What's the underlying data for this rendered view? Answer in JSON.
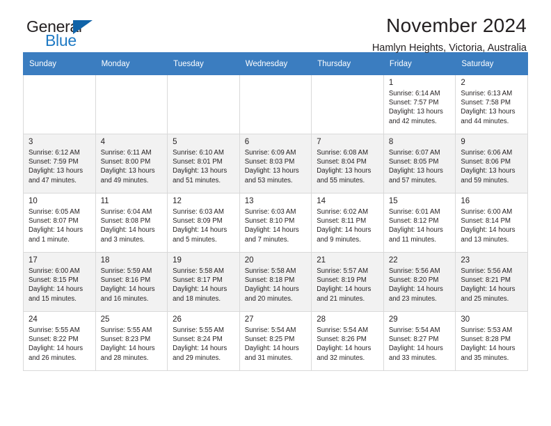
{
  "brand": {
    "name_top": "General",
    "name_bottom": "Blue",
    "triangle_icon": "triangle-icon",
    "colors": {
      "blue": "#1f7ac4",
      "dark_blue": "#1063a8",
      "text": "#231f20"
    }
  },
  "header": {
    "title": "November 2024",
    "subtitle": "Hamlyn Heights, Victoria, Australia"
  },
  "calendar": {
    "header_bg": "#3b7dc0",
    "weekdays": [
      "Sunday",
      "Monday",
      "Tuesday",
      "Wednesday",
      "Thursday",
      "Friday",
      "Saturday"
    ],
    "weeks": [
      [
        {
          "day": "",
          "sunrise": "",
          "sunset": "",
          "daylight": ""
        },
        {
          "day": "",
          "sunrise": "",
          "sunset": "",
          "daylight": ""
        },
        {
          "day": "",
          "sunrise": "",
          "sunset": "",
          "daylight": ""
        },
        {
          "day": "",
          "sunrise": "",
          "sunset": "",
          "daylight": ""
        },
        {
          "day": "",
          "sunrise": "",
          "sunset": "",
          "daylight": ""
        },
        {
          "day": "1",
          "sunrise": "Sunrise: 6:14 AM",
          "sunset": "Sunset: 7:57 PM",
          "daylight": "Daylight: 13 hours and 42 minutes."
        },
        {
          "day": "2",
          "sunrise": "Sunrise: 6:13 AM",
          "sunset": "Sunset: 7:58 PM",
          "daylight": "Daylight: 13 hours and 44 minutes."
        }
      ],
      [
        {
          "day": "3",
          "sunrise": "Sunrise: 6:12 AM",
          "sunset": "Sunset: 7:59 PM",
          "daylight": "Daylight: 13 hours and 47 minutes."
        },
        {
          "day": "4",
          "sunrise": "Sunrise: 6:11 AM",
          "sunset": "Sunset: 8:00 PM",
          "daylight": "Daylight: 13 hours and 49 minutes."
        },
        {
          "day": "5",
          "sunrise": "Sunrise: 6:10 AM",
          "sunset": "Sunset: 8:01 PM",
          "daylight": "Daylight: 13 hours and 51 minutes."
        },
        {
          "day": "6",
          "sunrise": "Sunrise: 6:09 AM",
          "sunset": "Sunset: 8:03 PM",
          "daylight": "Daylight: 13 hours and 53 minutes."
        },
        {
          "day": "7",
          "sunrise": "Sunrise: 6:08 AM",
          "sunset": "Sunset: 8:04 PM",
          "daylight": "Daylight: 13 hours and 55 minutes."
        },
        {
          "day": "8",
          "sunrise": "Sunrise: 6:07 AM",
          "sunset": "Sunset: 8:05 PM",
          "daylight": "Daylight: 13 hours and 57 minutes."
        },
        {
          "day": "9",
          "sunrise": "Sunrise: 6:06 AM",
          "sunset": "Sunset: 8:06 PM",
          "daylight": "Daylight: 13 hours and 59 minutes."
        }
      ],
      [
        {
          "day": "10",
          "sunrise": "Sunrise: 6:05 AM",
          "sunset": "Sunset: 8:07 PM",
          "daylight": "Daylight: 14 hours and 1 minute."
        },
        {
          "day": "11",
          "sunrise": "Sunrise: 6:04 AM",
          "sunset": "Sunset: 8:08 PM",
          "daylight": "Daylight: 14 hours and 3 minutes."
        },
        {
          "day": "12",
          "sunrise": "Sunrise: 6:03 AM",
          "sunset": "Sunset: 8:09 PM",
          "daylight": "Daylight: 14 hours and 5 minutes."
        },
        {
          "day": "13",
          "sunrise": "Sunrise: 6:03 AM",
          "sunset": "Sunset: 8:10 PM",
          "daylight": "Daylight: 14 hours and 7 minutes."
        },
        {
          "day": "14",
          "sunrise": "Sunrise: 6:02 AM",
          "sunset": "Sunset: 8:11 PM",
          "daylight": "Daylight: 14 hours and 9 minutes."
        },
        {
          "day": "15",
          "sunrise": "Sunrise: 6:01 AM",
          "sunset": "Sunset: 8:12 PM",
          "daylight": "Daylight: 14 hours and 11 minutes."
        },
        {
          "day": "16",
          "sunrise": "Sunrise: 6:00 AM",
          "sunset": "Sunset: 8:14 PM",
          "daylight": "Daylight: 14 hours and 13 minutes."
        }
      ],
      [
        {
          "day": "17",
          "sunrise": "Sunrise: 6:00 AM",
          "sunset": "Sunset: 8:15 PM",
          "daylight": "Daylight: 14 hours and 15 minutes."
        },
        {
          "day": "18",
          "sunrise": "Sunrise: 5:59 AM",
          "sunset": "Sunset: 8:16 PM",
          "daylight": "Daylight: 14 hours and 16 minutes."
        },
        {
          "day": "19",
          "sunrise": "Sunrise: 5:58 AM",
          "sunset": "Sunset: 8:17 PM",
          "daylight": "Daylight: 14 hours and 18 minutes."
        },
        {
          "day": "20",
          "sunrise": "Sunrise: 5:58 AM",
          "sunset": "Sunset: 8:18 PM",
          "daylight": "Daylight: 14 hours and 20 minutes."
        },
        {
          "day": "21",
          "sunrise": "Sunrise: 5:57 AM",
          "sunset": "Sunset: 8:19 PM",
          "daylight": "Daylight: 14 hours and 21 minutes."
        },
        {
          "day": "22",
          "sunrise": "Sunrise: 5:56 AM",
          "sunset": "Sunset: 8:20 PM",
          "daylight": "Daylight: 14 hours and 23 minutes."
        },
        {
          "day": "23",
          "sunrise": "Sunrise: 5:56 AM",
          "sunset": "Sunset: 8:21 PM",
          "daylight": "Daylight: 14 hours and 25 minutes."
        }
      ],
      [
        {
          "day": "24",
          "sunrise": "Sunrise: 5:55 AM",
          "sunset": "Sunset: 8:22 PM",
          "daylight": "Daylight: 14 hours and 26 minutes."
        },
        {
          "day": "25",
          "sunrise": "Sunrise: 5:55 AM",
          "sunset": "Sunset: 8:23 PM",
          "daylight": "Daylight: 14 hours and 28 minutes."
        },
        {
          "day": "26",
          "sunrise": "Sunrise: 5:55 AM",
          "sunset": "Sunset: 8:24 PM",
          "daylight": "Daylight: 14 hours and 29 minutes."
        },
        {
          "day": "27",
          "sunrise": "Sunrise: 5:54 AM",
          "sunset": "Sunset: 8:25 PM",
          "daylight": "Daylight: 14 hours and 31 minutes."
        },
        {
          "day": "28",
          "sunrise": "Sunrise: 5:54 AM",
          "sunset": "Sunset: 8:26 PM",
          "daylight": "Daylight: 14 hours and 32 minutes."
        },
        {
          "day": "29",
          "sunrise": "Sunrise: 5:54 AM",
          "sunset": "Sunset: 8:27 PM",
          "daylight": "Daylight: 14 hours and 33 minutes."
        },
        {
          "day": "30",
          "sunrise": "Sunrise: 5:53 AM",
          "sunset": "Sunset: 8:28 PM",
          "daylight": "Daylight: 14 hours and 35 minutes."
        }
      ]
    ]
  }
}
